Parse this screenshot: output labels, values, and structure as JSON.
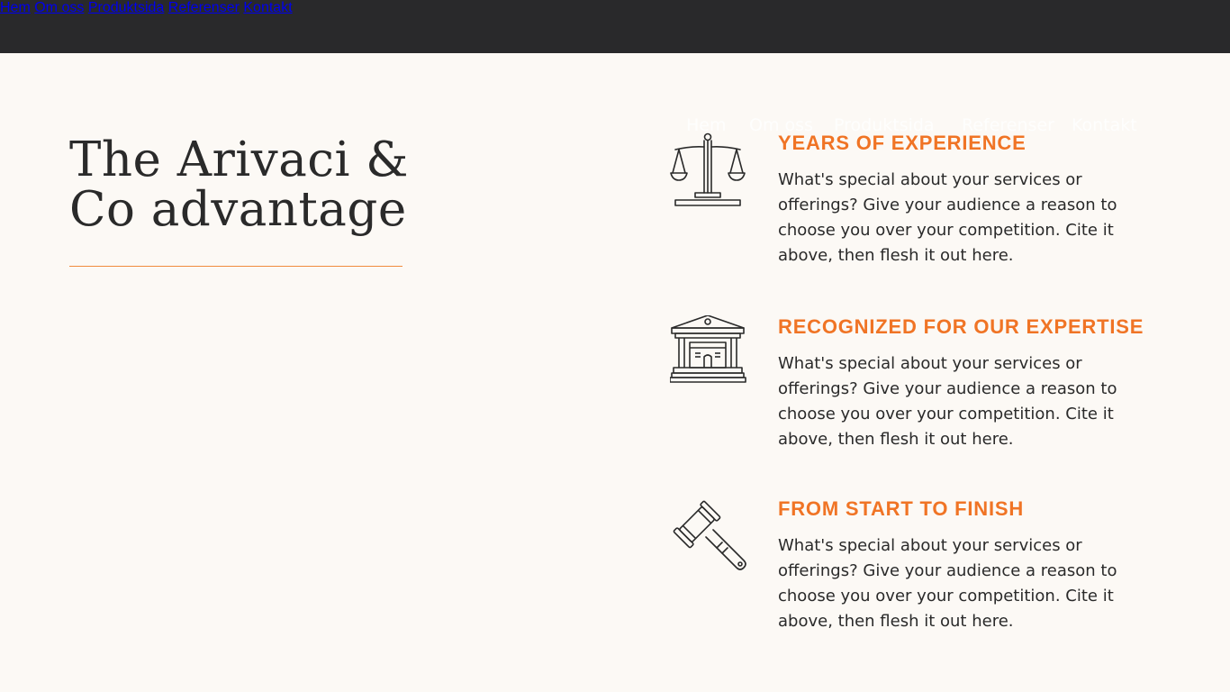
{
  "nav": {
    "items": [
      "Hem",
      "Om oss",
      "Produktsida",
      "Referenser",
      "Kontakt"
    ]
  },
  "ghost_nav": {
    "items": [
      "Hem",
      "Om oss",
      "Produktsida",
      "Referenser",
      "Kontakt"
    ]
  },
  "hero": {
    "title": "The Arivaci & Co advantage"
  },
  "features": [
    {
      "icon": "scales-icon",
      "title": "YEARS OF EXPERIENCE",
      "text": "What's special about your services or offerings? Give your audience a reason to choose you over your competition. Cite it above, then flesh it out here."
    },
    {
      "icon": "courthouse-icon",
      "title": "RECOGNIZED FOR OUR EXPERTISE",
      "text": "What's special about your services or offerings? Give your audience a reason to choose you over your competition. Cite it above, then flesh it out here."
    },
    {
      "icon": "gavel-icon",
      "title": "FROM START TO FINISH",
      "text": "What's special about your services or offerings? Give your audience a reason to choose you over your competition. Cite it above, then flesh it out here."
    }
  ],
  "colors": {
    "topbar": "#29292b",
    "background": "#fcf9f5",
    "accent": "#f07425"
  }
}
